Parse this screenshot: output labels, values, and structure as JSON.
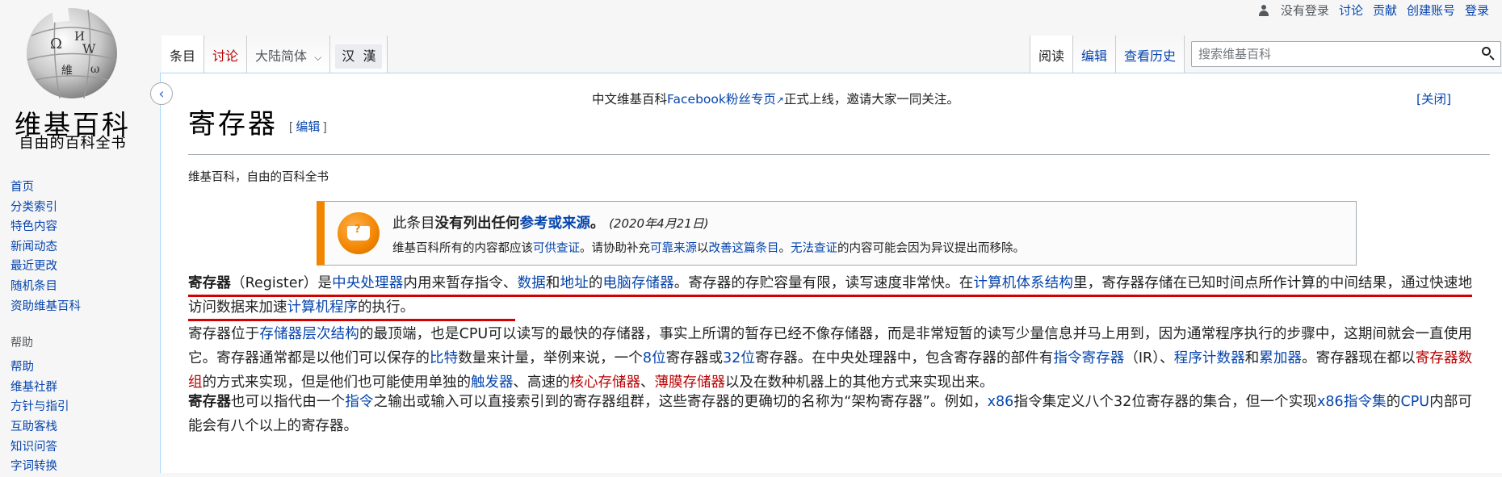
{
  "personal": {
    "not_logged_in": "没有登录",
    "talk": "讨论",
    "contributions": "贡献",
    "create_account": "创建账号",
    "login": "登录"
  },
  "logo": {
    "wordmark": "维基百科",
    "tagline": "自由的百科全书",
    "globe_glyphs": [
      "Ω",
      "И",
      "W",
      "維",
      "ω"
    ]
  },
  "sidebar": {
    "nav": [
      "首页",
      "分类索引",
      "特色内容",
      "新闻动态",
      "最近更改",
      "随机条目",
      "资助维基百科"
    ],
    "help_title": "帮助",
    "help": [
      "帮助",
      "维基社群",
      "方针与指引",
      "互助客栈",
      "知识问答",
      "字词转换"
    ]
  },
  "tabs": {
    "article": "条目",
    "talk": "讨论",
    "variant": "大陆简体",
    "script_simplified": "汉",
    "script_traditional": "漢",
    "read": "阅读",
    "edit": "编辑",
    "history": "查看历史"
  },
  "search": {
    "placeholder": "搜索维基百科"
  },
  "sitenotice": {
    "pre": "中文维基百科",
    "link": "Facebook粉丝专页",
    "post": "正式上线，邀请大家一同关注。",
    "close": "[关闭]"
  },
  "title": {
    "text": "寄存器",
    "edit_open": "[ ",
    "edit": "编辑",
    "edit_close": " ]"
  },
  "sitesub": "维基百科，自由的百科全书",
  "ambox": {
    "pre": "此条目",
    "bold1": "没有列出任何",
    "link1": "参考或来源",
    "period": "。",
    "date": "(2020年4月21日)",
    "line2_a": "维基百科所有的内容都应该",
    "line2_link1": "可供查证",
    "line2_b": "。请协助补充",
    "line2_link2": "可靠来源",
    "line2_c": "以",
    "line2_link3": "改善这篇条目",
    "line2_d": "。",
    "line2_link4": "无法查证",
    "line2_e": "的内容可能会因为异议提出而移除。"
  },
  "p1": {
    "bold": "寄存器",
    "a": "（Register）是",
    "l1": "中央处理器",
    "b": "内用来暂存指令、",
    "l2": "数据",
    "c": "和",
    "l3": "地址",
    "d": "的",
    "l4": "电脑存储器",
    "e": "。寄存器的存贮容量有限，读写速度非常快。在",
    "l5": "计算机体系结构",
    "f": "里，寄存器存储在已知时间点所作计算的中间结果，通过快速地访问数据来加速",
    "l6": "计算机程序",
    "g": "的执行。"
  },
  "p2": {
    "a": "寄存器位于",
    "l1": "存储器层次结构",
    "b": "的最顶端，也是CPU可以读写的最快的存储器，事实上所谓的暂存已经不像存储器，而是非常短暂的读写少量信息并马上用到，因为通常程序执行的步骤中，这期间就会一直使用它。寄存器通常都是以他们可以保存的",
    "l2": "比特",
    "c": "数量来计量，举例来说，一个",
    "l3": "8位",
    "d": "寄存器或",
    "l4": "32位",
    "e": "寄存器。在中央处理器中，包含寄存器的部件有",
    "l5": "指令寄存器",
    "f": "（IR）、",
    "l6": "程序计数器",
    "g": "和",
    "l7": "累加器",
    "h": "。寄存器现在都以",
    "r1": "寄存器数组",
    "i": "的方式来实现，但是他们也可能使用单独的",
    "l8": "触发器",
    "j": "、高速的",
    "r2": "核心存储器",
    "k": "、",
    "r3": "薄膜存储器",
    "m": "以及在数种机器上的其他方式来实现出来。"
  },
  "p3": {
    "bold": "寄存器",
    "a": "也可以指代由一个",
    "l1": "指令",
    "b": "之输出或输入可以直接索引到的寄存器组群，这些寄存器的更确切的名称为“架构寄存器”。例如，",
    "l2": "x86",
    "c": "指令集定义八个32位寄存器的集合，但一个实现",
    "l3": "x86指令集",
    "d": "的",
    "l4": "CPU",
    "e": "内部可能会有八个以上的寄存器。"
  },
  "colors": {
    "link": "#0645ad",
    "redlink": "#ba0000",
    "ambox_accent": "#f28500",
    "annotation_underline": "#d40000"
  }
}
